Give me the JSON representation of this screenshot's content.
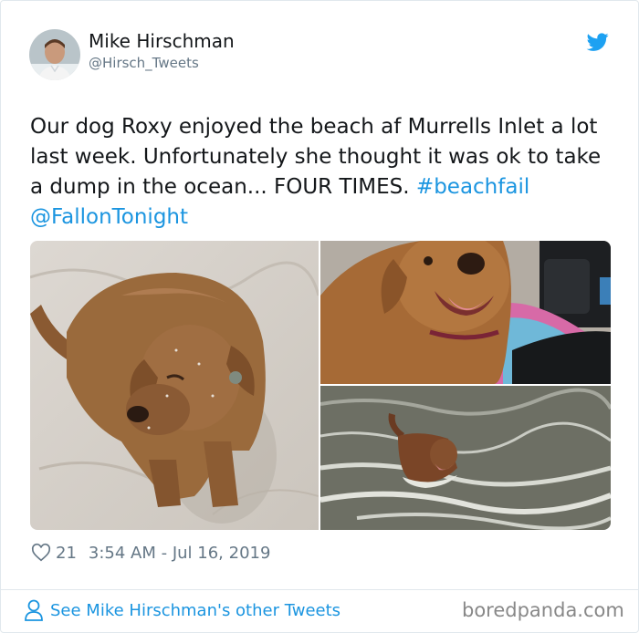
{
  "author": {
    "name": "Mike Hirschman",
    "handle": "@Hirsch_Tweets"
  },
  "tweet": {
    "text_plain": "Our dog Roxy enjoyed the beach af Murrells Inlet a lot last week. Unfortunately she thought it was ok to take a dump in the ocean... FOUR TIMES.",
    "hashtag": "#beachfail",
    "mention": "@FallonTonight"
  },
  "stats": {
    "likes": "21",
    "timestamp": "3:54 AM - Jul 16, 2019"
  },
  "footer": {
    "see_more_label": "See Mike Hirschman's other Tweets",
    "watermark": "boredpanda.com"
  },
  "colors": {
    "link": "#1b95e0",
    "twitter_blue": "#1da1f2",
    "muted": "#657786"
  },
  "icons": [
    "twitter-bird-icon",
    "heart-icon",
    "person-icon"
  ]
}
